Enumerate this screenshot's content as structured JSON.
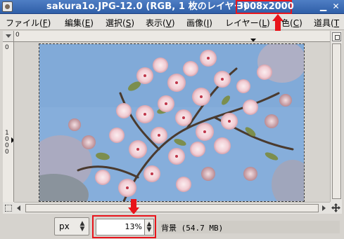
{
  "window": {
    "title": "sakura1o.JPG-12.0 (RGB, 1 枚のレイヤー)",
    "dimensions": "3008x2000",
    "close_glyph": "✕",
    "icon": "gimp-image-icon"
  },
  "menubar": {
    "items": [
      {
        "label": "ファイル(",
        "mnemonic": "F",
        "suffix": ")"
      },
      {
        "label": "編集(",
        "mnemonic": "E",
        "suffix": ")"
      },
      {
        "label": "選択(",
        "mnemonic": "S",
        "suffix": ")"
      },
      {
        "label": "表示(",
        "mnemonic": "V",
        "suffix": ")"
      },
      {
        "label": "画像(",
        "mnemonic": "I",
        "suffix": ")"
      },
      {
        "label": "レイヤー(",
        "mnemonic": "L",
        "suffix": ")"
      },
      {
        "label": "色(",
        "mnemonic": "C",
        "suffix": ")"
      },
      {
        "label": "道具(",
        "mnemonic": "T",
        "suffix": ""
      }
    ]
  },
  "ruler": {
    "top_label": "0",
    "left_labels": [
      "0",
      "1",
      "0",
      "0",
      "0"
    ]
  },
  "statusbar": {
    "unit": "px",
    "zoom": "13%",
    "info": "背景 (54.7 MB)"
  },
  "colors": {
    "highlight": "#e8141b",
    "sky": "#86aedb",
    "titlebar": "#3566b2"
  },
  "image": {
    "description_name": "cherry-blossom-photo"
  }
}
